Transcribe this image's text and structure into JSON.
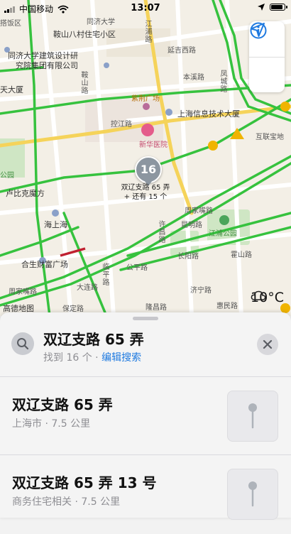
{
  "status_bar": {
    "carrier": "中国移动",
    "time": "13:07",
    "signal_level": 0.5,
    "battery_level": 0.85,
    "icons": [
      "signal-icon",
      "wifi-icon",
      "location-arrow-icon",
      "battery-icon"
    ]
  },
  "map": {
    "labels": {
      "district_top_left": "搭饭区",
      "road_top": "同济大学",
      "community_1": "鞍山八村住宅小区",
      "road_jiangpu": "江浦路",
      "institute_1": "同济大学建筑设计研",
      "institute_2": "究院集团有限公司",
      "road_yanji": "延吉西路",
      "road_anshan": "鞍山路",
      "road_benxi": "本溪路",
      "building_tianda": "天大厦",
      "mall_zijing": "紫荆广场",
      "road_fengcheng": "凤城路",
      "company_shanghai_info": "上海信息技术大厦",
      "road_kongjiang": "控江路",
      "hospital_xinhua": "新华医院",
      "building_hulian": "互联宝地",
      "park_left": "公园",
      "lubike_square": "卢比克魔方",
      "caption_name": "双辽支路 65 弄",
      "caption_more": "+ 还有 15 个",
      "road_zhoujia": "周家嘴路",
      "haishanghai": "海上海",
      "road_kunming": "昆明路",
      "park_jiangpu": "江浦公园",
      "road_xuchang": "许昌路",
      "mall_hesheng": "合生财富广场",
      "road_changyang": "长阳路",
      "road_huoshan": "霍山路",
      "road_gongping": "公平路",
      "road_daliang": "大连路",
      "road_linping": "临平路",
      "road_jining": "济宁路",
      "road_huimin": "惠民路",
      "road_zhoujia2": "周家嘴路",
      "shop_bottom": "高德地图",
      "road_baoding": "保定路",
      "road_longchang": "隆昌路"
    },
    "cluster_pin_count": "16",
    "controls": {
      "info_icon": "info-icon",
      "location_icon": "location-arrow-icon"
    },
    "weather": {
      "icon": "cloud-icon",
      "temperature": "10°C"
    }
  },
  "sheet": {
    "search_title": "双辽支路 65 弄",
    "found_text": "找到 16 个",
    "separator": " · ",
    "edit_search": "编辑搜索",
    "results": [
      {
        "title": "双辽支路 65 弄",
        "subtitle": "上海市 · 7.5 公里"
      },
      {
        "title": "双辽支路 65 弄 13 号",
        "subtitle": "商务住宅相关 · 7.5 公里"
      }
    ]
  }
}
